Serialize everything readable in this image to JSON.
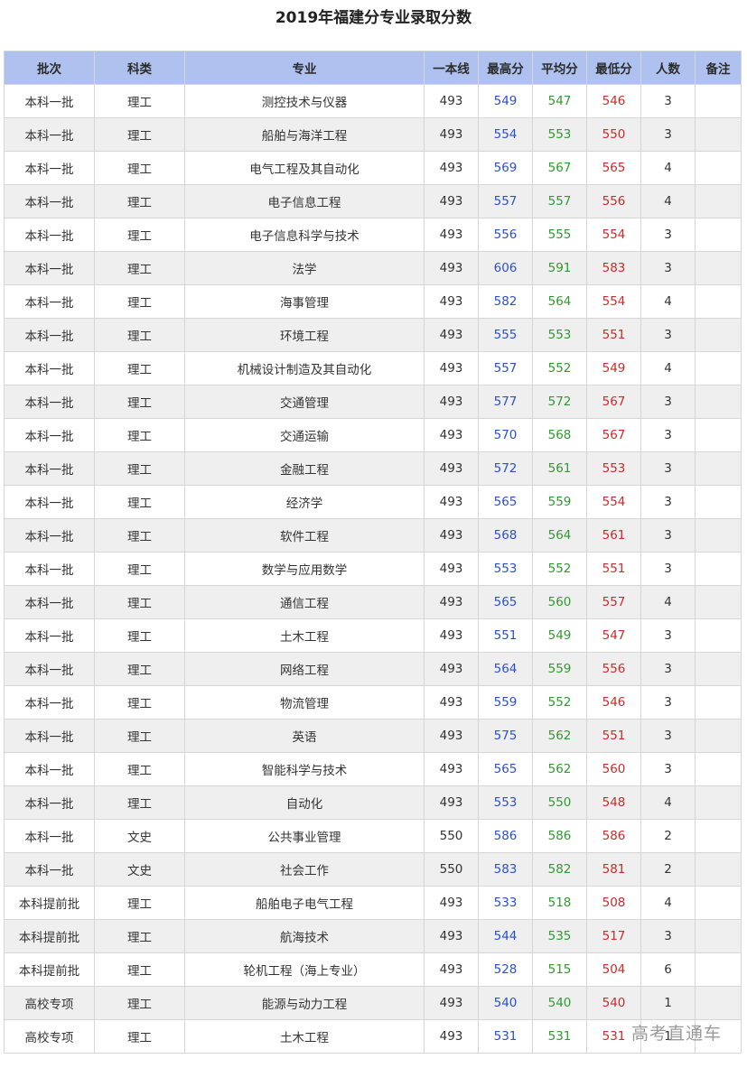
{
  "title": "2019年福建分专业录取分数",
  "colors": {
    "header_bg": "#aec1ef",
    "max": "#2b4fd6",
    "avg": "#2f9a2f",
    "min": "#cc2b2b",
    "stripe": "#efefef"
  },
  "columns": [
    "批次",
    "科类",
    "专业",
    "一本线",
    "最高分",
    "平均分",
    "最低分",
    "人数",
    "备注"
  ],
  "rows": [
    [
      "本科一批",
      "理工",
      "测控技术与仪器",
      "493",
      "549",
      "547",
      "546",
      "3",
      ""
    ],
    [
      "本科一批",
      "理工",
      "船舶与海洋工程",
      "493",
      "554",
      "553",
      "550",
      "3",
      ""
    ],
    [
      "本科一批",
      "理工",
      "电气工程及其自动化",
      "493",
      "569",
      "567",
      "565",
      "4",
      ""
    ],
    [
      "本科一批",
      "理工",
      "电子信息工程",
      "493",
      "557",
      "557",
      "556",
      "4",
      ""
    ],
    [
      "本科一批",
      "理工",
      "电子信息科学与技术",
      "493",
      "556",
      "555",
      "554",
      "3",
      ""
    ],
    [
      "本科一批",
      "理工",
      "法学",
      "493",
      "606",
      "591",
      "583",
      "3",
      ""
    ],
    [
      "本科一批",
      "理工",
      "海事管理",
      "493",
      "582",
      "564",
      "554",
      "4",
      ""
    ],
    [
      "本科一批",
      "理工",
      "环境工程",
      "493",
      "555",
      "553",
      "551",
      "3",
      ""
    ],
    [
      "本科一批",
      "理工",
      "机械设计制造及其自动化",
      "493",
      "557",
      "552",
      "549",
      "4",
      ""
    ],
    [
      "本科一批",
      "理工",
      "交通管理",
      "493",
      "577",
      "572",
      "567",
      "3",
      ""
    ],
    [
      "本科一批",
      "理工",
      "交通运输",
      "493",
      "570",
      "568",
      "567",
      "3",
      ""
    ],
    [
      "本科一批",
      "理工",
      "金融工程",
      "493",
      "572",
      "561",
      "553",
      "3",
      ""
    ],
    [
      "本科一批",
      "理工",
      "经济学",
      "493",
      "565",
      "559",
      "554",
      "3",
      ""
    ],
    [
      "本科一批",
      "理工",
      "软件工程",
      "493",
      "568",
      "564",
      "561",
      "3",
      ""
    ],
    [
      "本科一批",
      "理工",
      "数学与应用数学",
      "493",
      "553",
      "552",
      "551",
      "3",
      ""
    ],
    [
      "本科一批",
      "理工",
      "通信工程",
      "493",
      "565",
      "560",
      "557",
      "4",
      ""
    ],
    [
      "本科一批",
      "理工",
      "土木工程",
      "493",
      "551",
      "549",
      "547",
      "3",
      ""
    ],
    [
      "本科一批",
      "理工",
      "网络工程",
      "493",
      "564",
      "559",
      "556",
      "3",
      ""
    ],
    [
      "本科一批",
      "理工",
      "物流管理",
      "493",
      "559",
      "552",
      "546",
      "3",
      ""
    ],
    [
      "本科一批",
      "理工",
      "英语",
      "493",
      "575",
      "562",
      "551",
      "3",
      ""
    ],
    [
      "本科一批",
      "理工",
      "智能科学与技术",
      "493",
      "565",
      "562",
      "560",
      "3",
      ""
    ],
    [
      "本科一批",
      "理工",
      "自动化",
      "493",
      "553",
      "550",
      "548",
      "4",
      ""
    ],
    [
      "本科一批",
      "文史",
      "公共事业管理",
      "550",
      "586",
      "586",
      "586",
      "2",
      ""
    ],
    [
      "本科一批",
      "文史",
      "社会工作",
      "550",
      "583",
      "582",
      "581",
      "2",
      ""
    ],
    [
      "本科提前批",
      "理工",
      "船舶电子电气工程",
      "493",
      "533",
      "518",
      "508",
      "4",
      ""
    ],
    [
      "本科提前批",
      "理工",
      "航海技术",
      "493",
      "544",
      "535",
      "517",
      "3",
      ""
    ],
    [
      "本科提前批",
      "理工",
      "轮机工程（海上专业）",
      "493",
      "528",
      "515",
      "504",
      "6",
      ""
    ],
    [
      "高校专项",
      "理工",
      "能源与动力工程",
      "493",
      "540",
      "540",
      "540",
      "1",
      ""
    ],
    [
      "高校专项",
      "理工",
      "土木工程",
      "493",
      "531",
      "531",
      "531",
      "1",
      ""
    ]
  ],
  "watermark": "高考直通车"
}
